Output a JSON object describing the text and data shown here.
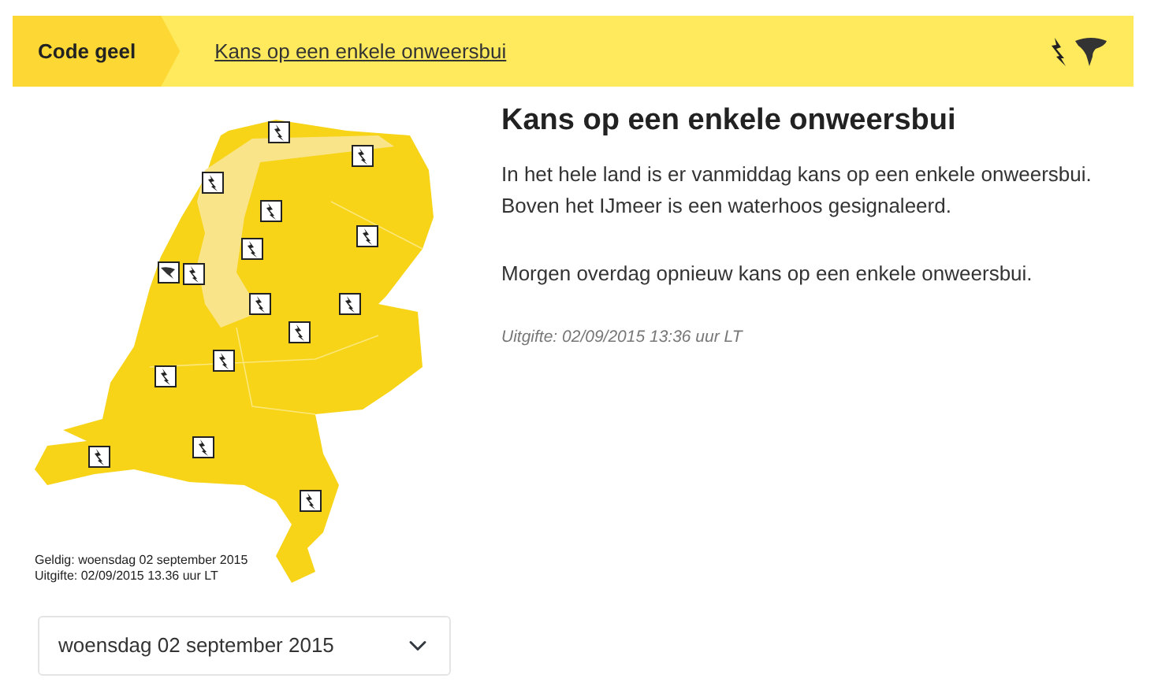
{
  "banner": {
    "code": "Code geel",
    "headline": "Kans op een enkele onweersbui"
  },
  "map": {
    "captions": [
      "Geldig: woensdag 02 september 2015",
      "Uitgifte: 02/09/2015 13.36 uur LT"
    ]
  },
  "date_select": {
    "value": "woensdag 02 september 2015"
  },
  "warning": {
    "title": "Kans op een enkele onweersbui",
    "paragraphs": [
      "In het hele land is er vanmiddag kans op een enkele onweersbui. Boven het IJmeer is een waterhoos gesignaleerd.",
      "Morgen overdag opnieuw kans op een enkele onweersbui."
    ],
    "issued": "Uitgifte: 02/09/2015 13:36 uur LT"
  }
}
